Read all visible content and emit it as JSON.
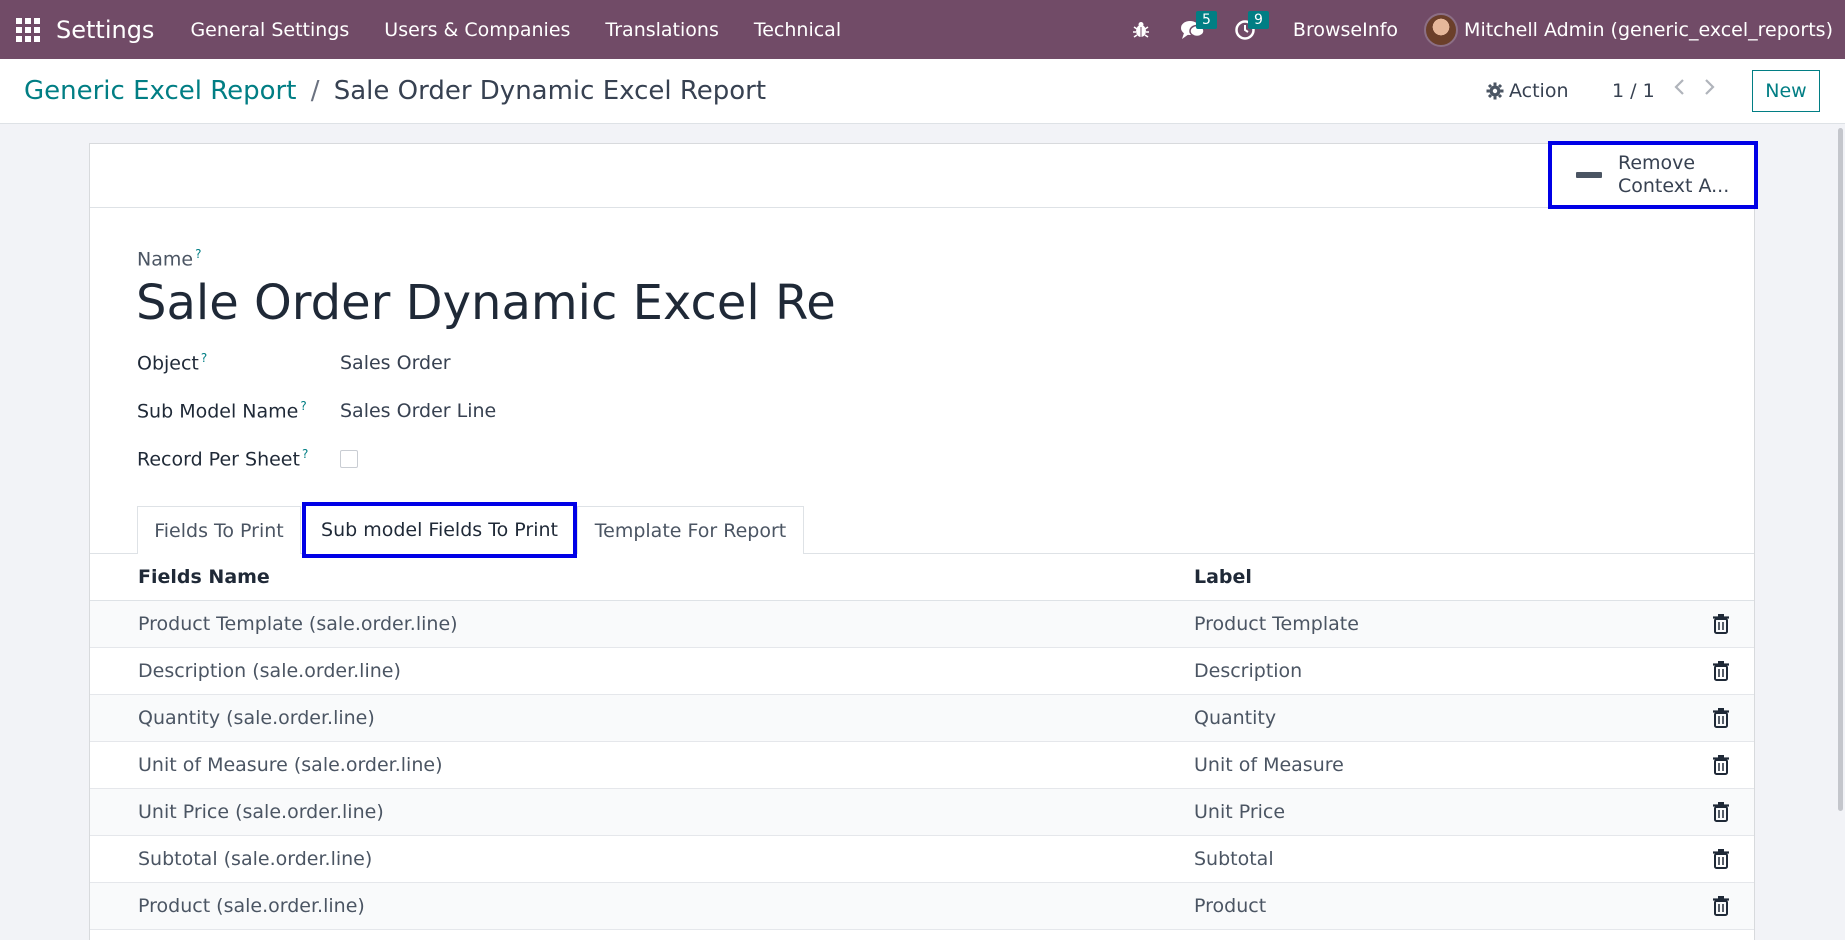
{
  "navbar": {
    "app_name": "Settings",
    "menus": [
      "General Settings",
      "Users & Companies",
      "Translations",
      "Technical"
    ],
    "messages_count": "5",
    "activities_count": "9",
    "company": "BrowseInfo",
    "user": "Mitchell Admin (generic_excel_reports)"
  },
  "control": {
    "breadcrumb_parent": "Generic Excel Report",
    "breadcrumb_sep": "/",
    "breadcrumb_current": "Sale Order Dynamic Excel Report",
    "action_label": "Action",
    "pager": "1 / 1",
    "new_label": "New"
  },
  "statusbar": {
    "context_button_label": "Remove Context A..."
  },
  "form": {
    "name_label": "Name",
    "help_mark": "?",
    "title": "Sale Order Dynamic Excel Re",
    "object_label": "Object",
    "object_value": "Sales Order",
    "sub_model_label": "Sub Model Name",
    "sub_model_value": "Sales Order Line",
    "record_per_sheet_label": "Record Per Sheet",
    "record_per_sheet_checked": false
  },
  "tabs": [
    {
      "label": "Fields To Print",
      "active": false
    },
    {
      "label": "Sub model Fields To Print",
      "active": true
    },
    {
      "label": "Template For Report",
      "active": false
    }
  ],
  "table": {
    "headers": {
      "name": "Fields Name",
      "label": "Label"
    },
    "rows": [
      {
        "name": "Product Template (sale.order.line)",
        "label": "Product Template"
      },
      {
        "name": "Description (sale.order.line)",
        "label": "Description"
      },
      {
        "name": "Quantity (sale.order.line)",
        "label": "Quantity"
      },
      {
        "name": "Unit of Measure (sale.order.line)",
        "label": "Unit of Measure"
      },
      {
        "name": "Unit Price (sale.order.line)",
        "label": "Unit Price"
      },
      {
        "name": "Subtotal (sale.order.line)",
        "label": "Subtotal"
      },
      {
        "name": "Product (sale.order.line)",
        "label": "Product"
      }
    ]
  },
  "colors": {
    "navbar": "#714b67",
    "accent": "#017e84",
    "highlight_border": "#0000e6"
  },
  "icons": [
    "apps-grid-icon",
    "bug-icon",
    "chat-icon",
    "clock-icon",
    "gear-icon",
    "chevron-left-icon",
    "chevron-right-icon",
    "minus-icon",
    "trash-icon"
  ]
}
